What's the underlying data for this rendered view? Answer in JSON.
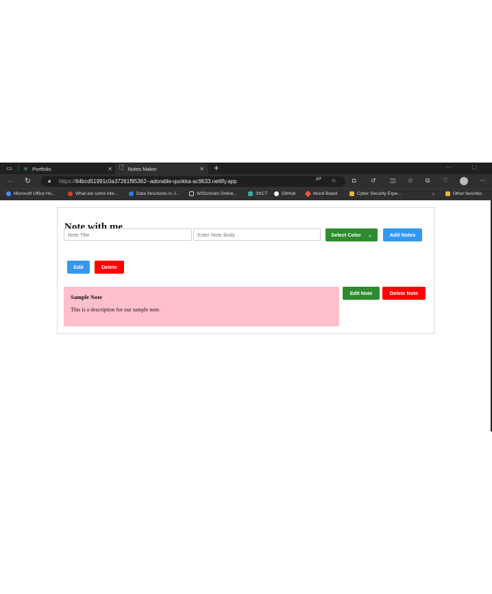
{
  "browser": {
    "tabs": [
      {
        "label": "Portfolio",
        "icon": "react-icon"
      },
      {
        "label": "Notes Maker",
        "icon": "page-icon"
      }
    ],
    "url_prefix": "https://",
    "url_host": "64bcd51991c0a37261f95362--adorable-quokka-ac9633.netlify.app",
    "favorites": [
      {
        "label": "Microsoft Office Ho...",
        "color": "#4a8cf0"
      },
      {
        "label": "What are some inte...",
        "color": "#e03a2a"
      },
      {
        "label": "Data Structures in J...",
        "color": "#2f7de1"
      },
      {
        "label": "W3Schools Online...",
        "color": "#dddddd"
      },
      {
        "label": "SKCT",
        "color": "#3aa8a8"
      },
      {
        "label": "GitHub",
        "color": "#ffffff"
      },
      {
        "label": "Mood Board",
        "color": "#e2584a"
      },
      {
        "label": "Cyber Security Expe...",
        "color": "#e8b53b"
      },
      {
        "label": "Other favorites",
        "color": "#e8b53b"
      }
    ]
  },
  "app": {
    "heading": "Note with me",
    "title_placeholder": "Note Tilte",
    "body_placeholder": "Enter Note Body",
    "select_color_label": "Select Color",
    "add_label": "Add Notes",
    "edit_label": "Edit",
    "delete_label": "Delete",
    "edit_note_label": "Edit Note",
    "delete_note_label": "Delete Note",
    "colors": {
      "green": "#2e8b2e",
      "blue": "#3498f0",
      "red": "#ff0000",
      "note_bg": "#ffc0cb"
    }
  },
  "notes": [
    {
      "title": "Sample Note",
      "body": "This is a description for our sample note."
    }
  ]
}
